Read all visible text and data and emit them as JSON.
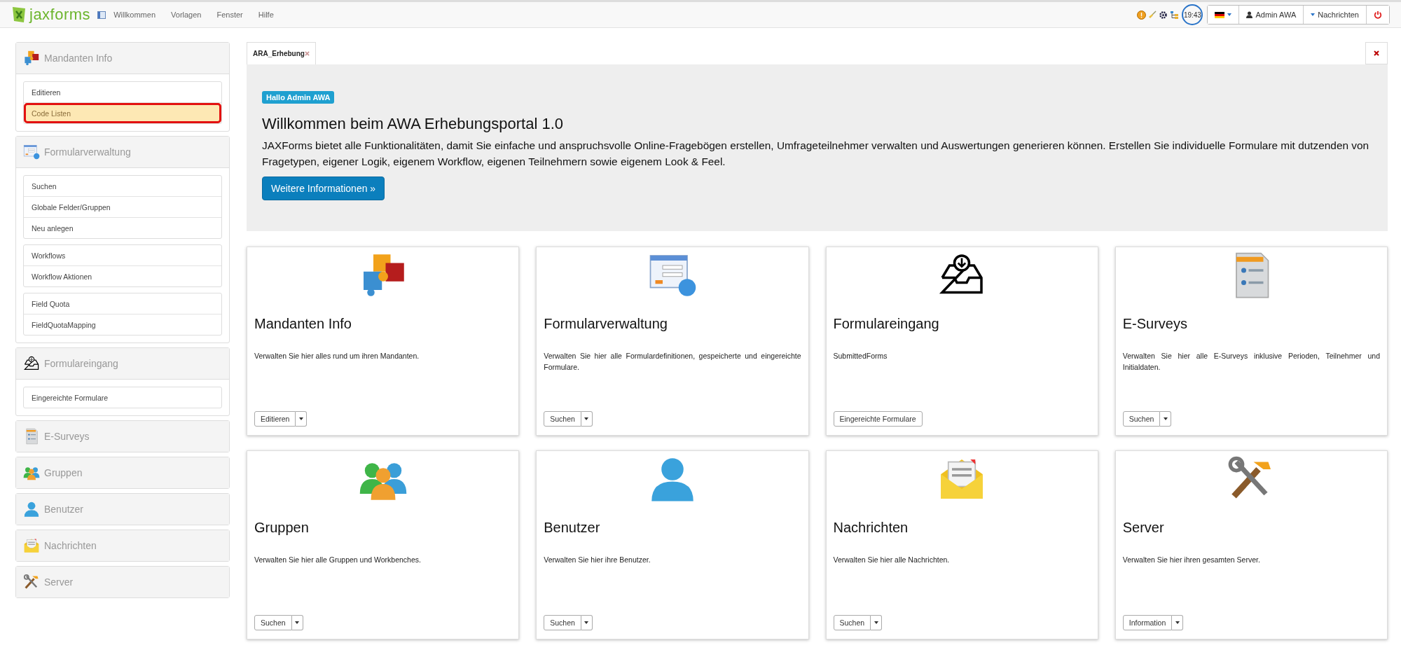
{
  "topbar": {
    "logo": "jaxforms",
    "menu": [
      "Willkommen",
      "Vorlagen",
      "Fenster",
      "Hilfe"
    ],
    "clock": "19:43",
    "user": "Admin AWA",
    "messages": "Nachrichten"
  },
  "sidebar": [
    {
      "title": "Mandanten Info",
      "expanded": true,
      "groups": [
        [
          {
            "label": "Editieren",
            "selected": false
          },
          {
            "label": "Code Listen",
            "selected": true
          }
        ]
      ]
    },
    {
      "title": "Formularverwaltung",
      "expanded": true,
      "groups": [
        [
          {
            "label": "Suchen",
            "selected": false
          },
          {
            "label": "Globale Felder/Gruppen",
            "selected": false
          },
          {
            "label": "Neu anlegen",
            "selected": false
          }
        ],
        [
          {
            "label": "Workflows",
            "selected": false
          },
          {
            "label": "Workflow Aktionen",
            "selected": false
          }
        ],
        [
          {
            "label": "Field Quota",
            "selected": false
          },
          {
            "label": "FieldQuotaMapping",
            "selected": false
          }
        ]
      ]
    },
    {
      "title": "Formulareingang",
      "expanded": true,
      "groups": [
        [
          {
            "label": "Eingereichte Formulare",
            "selected": false
          }
        ]
      ]
    },
    {
      "title": "E-Surveys",
      "expanded": false
    },
    {
      "title": "Gruppen",
      "expanded": false
    },
    {
      "title": "Benutzer",
      "expanded": false
    },
    {
      "title": "Nachrichten",
      "expanded": false
    },
    {
      "title": "Server",
      "expanded": false
    }
  ],
  "tabs": [
    {
      "label": "ARA_Erhebung",
      "selected": true
    }
  ],
  "banner": {
    "badge": "Hallo Admin AWA",
    "title": "Willkommen beim AWA Erhebungsportal 1.0",
    "text": "JAXForms bietet alle Funktionalitäten, damit Sie einfache und anspruchsvolle Online-Fragebögen erstellen, Umfrageteilnehmer verwalten und Auswertungen generieren können. Erstellen Sie individuelle Formulare mit dutzenden von Fragetypen, eigener Logik, eigenem Workflow, eigenen Teilnehmern sowie eigenem Look & Feel.",
    "button": "Weitere Informationen »"
  },
  "cards": [
    {
      "title": "Mandanten Info",
      "text": "Verwalten Sie hier alles rund um ihren Mandanten.",
      "button": "Editieren",
      "split": true
    },
    {
      "title": "Formularverwaltung",
      "text": "Verwalten Sie hier alle Formulardefinitionen, gespeicherte und eingereichte Formulare.",
      "button": "Suchen",
      "split": true
    },
    {
      "title": "Formulareingang",
      "text": "SubmittedForms",
      "button": "Eingereichte Formulare",
      "split": false
    },
    {
      "title": "E-Surveys",
      "text": "Verwalten Sie hier alle E-Surveys inklusive Perioden, Teilnehmer und Initialdaten.",
      "button": "Suchen",
      "split": true
    },
    {
      "title": "Gruppen",
      "text": "Verwalten Sie hier alle Gruppen und Workbenches.",
      "button": "Suchen",
      "split": true
    },
    {
      "title": "Benutzer",
      "text": "Verwalten Sie hier ihre Benutzer.",
      "button": "Suchen",
      "split": true
    },
    {
      "title": "Nachrichten",
      "text": "Verwalten Sie hier alle Nachrichten.",
      "button": "Suchen",
      "split": true
    },
    {
      "title": "Server",
      "text": "Verwalten Sie hier ihren gesamten Server.",
      "button": "Information",
      "split": true
    }
  ]
}
